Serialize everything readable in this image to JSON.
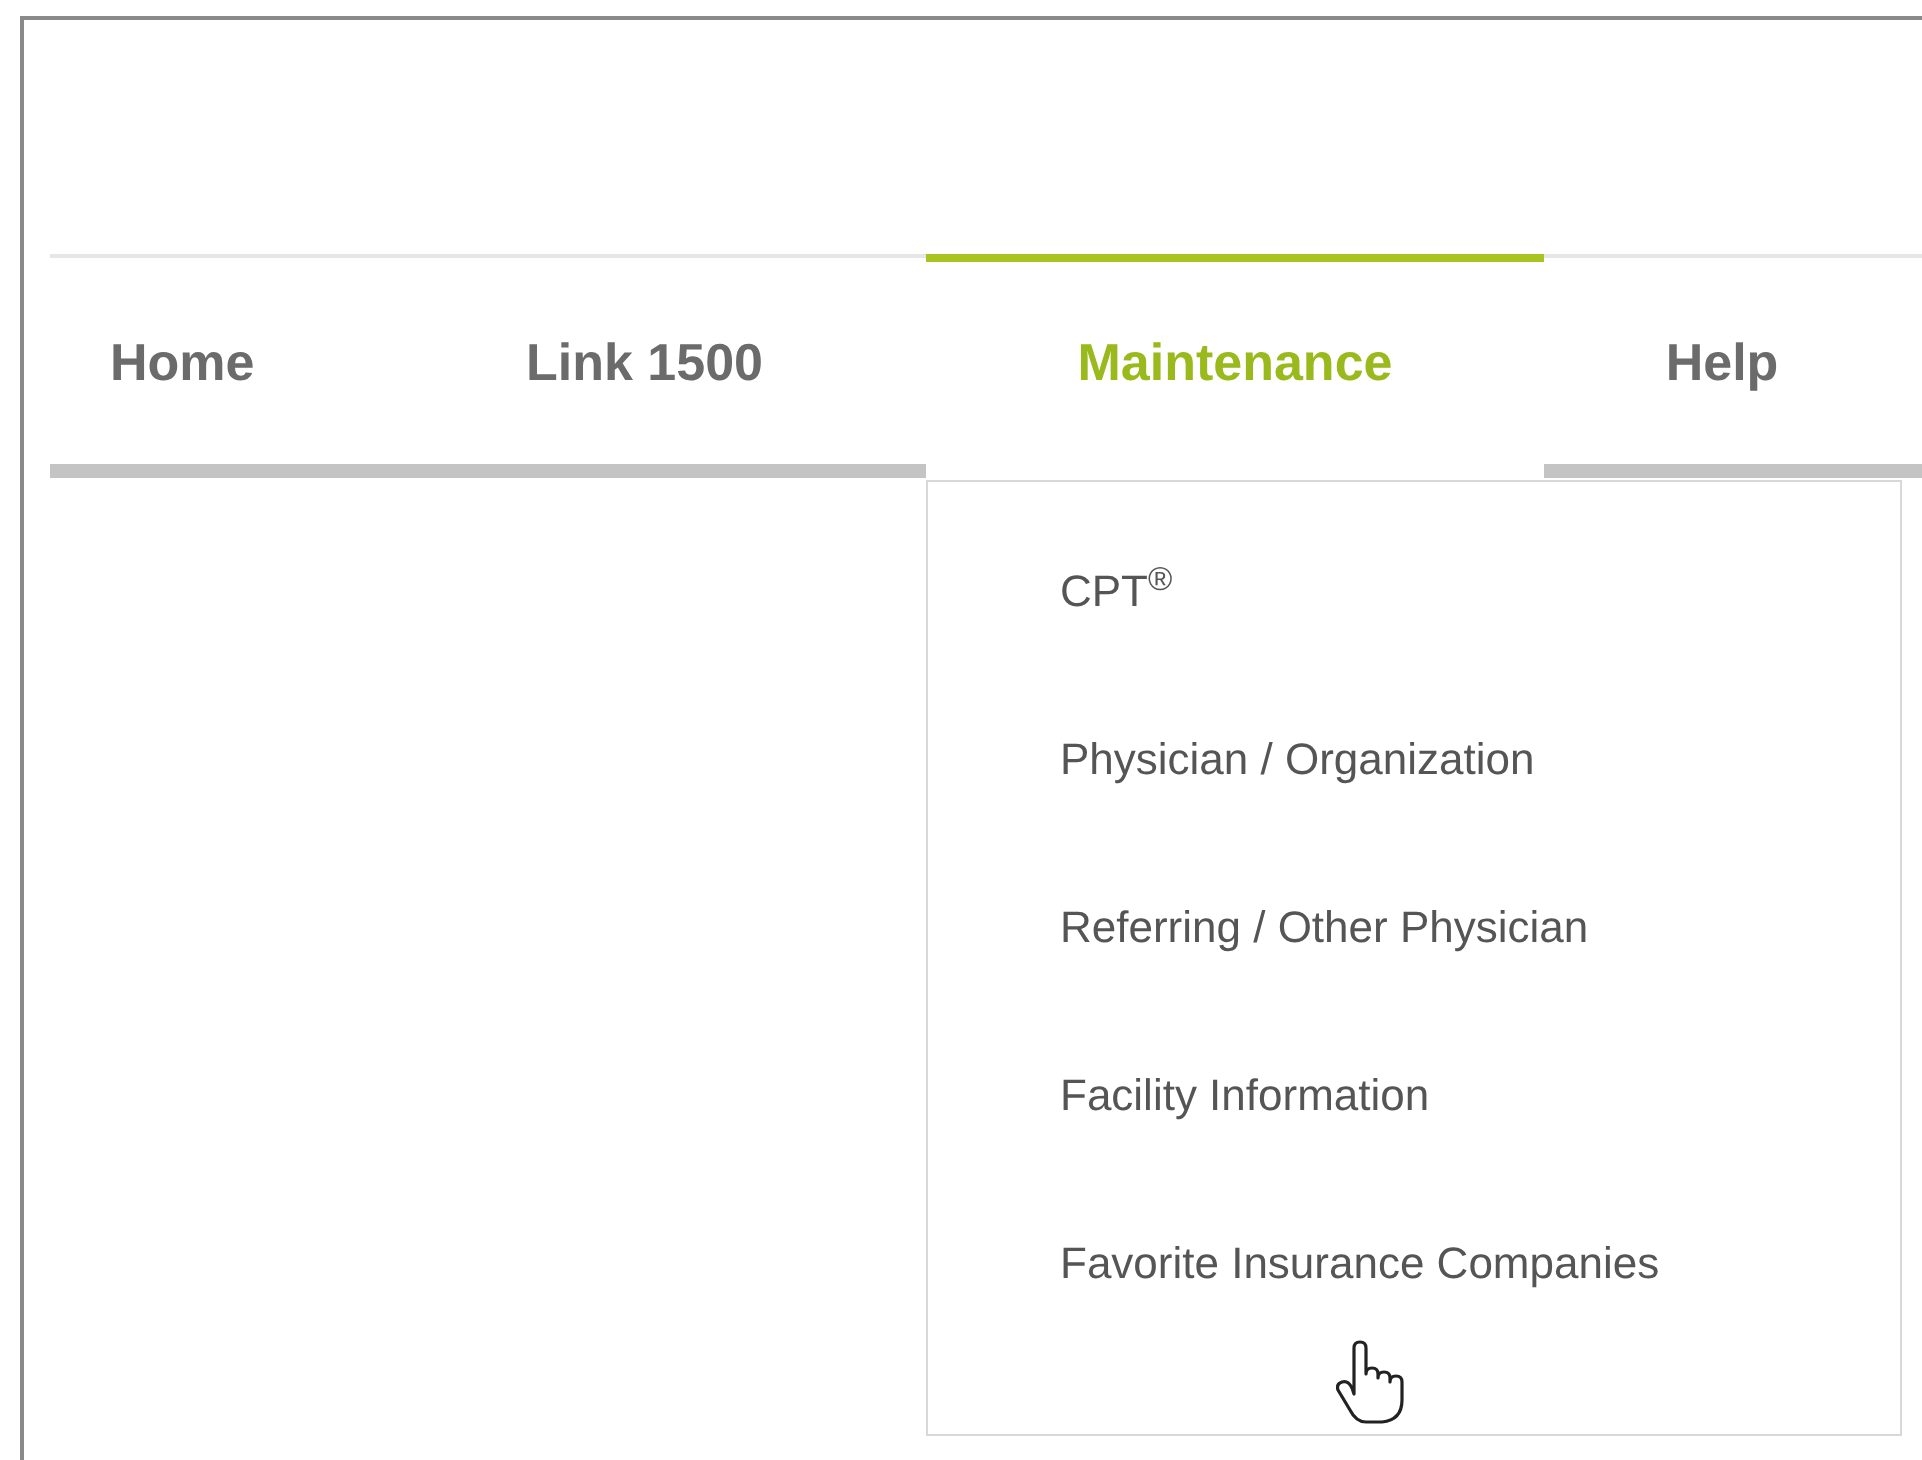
{
  "tabs": [
    {
      "label": "Home",
      "selected": false
    },
    {
      "label": "Link 1500",
      "selected": false
    },
    {
      "label": "Maintenance",
      "selected": true
    },
    {
      "label": "Help",
      "selected": false
    }
  ],
  "menu": {
    "items": [
      {
        "label": "CPT$^{®}$"
      },
      {
        "label": "Physician / Organization"
      },
      {
        "label": "Referring / Other Physician"
      },
      {
        "label": "Facility Information"
      },
      {
        "label": "Favorite Insurance Companies"
      }
    ]
  }
}
